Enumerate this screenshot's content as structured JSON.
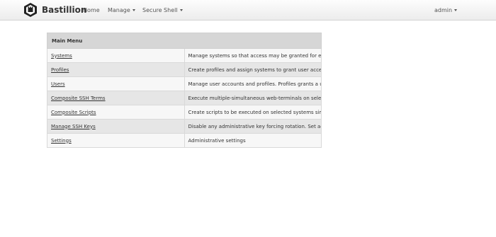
{
  "navbar": {
    "brand": "Bastillion",
    "logo_icon": "bastillion-logo-icon",
    "items": [
      {
        "label": "Home"
      },
      {
        "label": "Manage"
      },
      {
        "label": "Secure Shell"
      }
    ],
    "user": "admin"
  },
  "main_menu": {
    "heading": "Main Menu",
    "rows": [
      {
        "link": "Systems",
        "description": "Manage systems so that access may be granted for establishing SSH sessions."
      },
      {
        "link": "Profiles",
        "description": "Create profiles and assign systems to grant user access and distribute keys."
      },
      {
        "link": "Users",
        "description": "Manage user accounts and profiles. Profiles grants a user access to the defined systems."
      },
      {
        "link": "Composite SSH Terms",
        "description": "Execute multiple-simultaneous web-terminals on selected systems."
      },
      {
        "link": "Composite Scripts",
        "description": "Create scripts to be executed on selected systems simultaneously through a web-terminal."
      },
      {
        "link": "Manage SSH Keys",
        "description": "Disable any administrative key forcing rotation. Set additional public SSH keys for current user."
      },
      {
        "link": "Settings",
        "description": "Administrative settings"
      }
    ]
  }
}
